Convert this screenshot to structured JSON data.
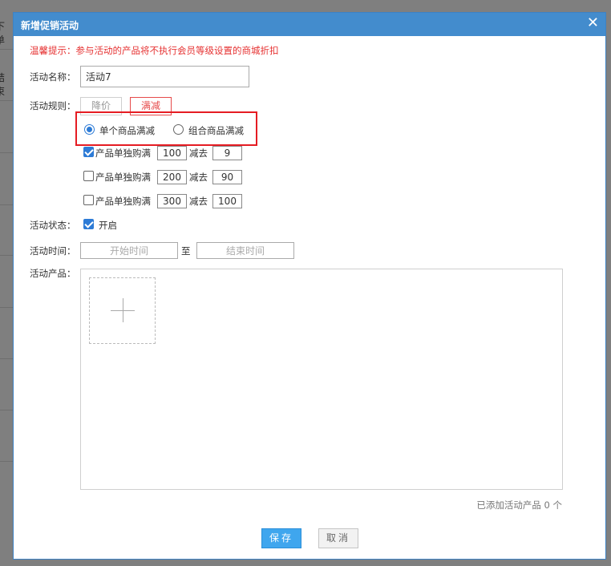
{
  "background": {
    "text_top": "下单",
    "text_mid": "结束"
  },
  "dialog": {
    "title": "新增促销活动",
    "close_glyph": "✕",
    "tip": "温馨提示：参与活动的产品将不执行会员等级设置的商城折扣",
    "name_label": "活动名称：",
    "name_value": "活动7",
    "rule_label": "活动规则：",
    "rule_tabs": [
      "降价",
      "满减"
    ],
    "active_rule": "满减",
    "mode_options": [
      {
        "label": "单个商品满减",
        "selected": true
      },
      {
        "label": "组合商品满减",
        "selected": false
      }
    ],
    "tiers": [
      {
        "checked": true,
        "label": "产品单独购满",
        "threshold": "100",
        "minus_label": "减去",
        "discount": "9"
      },
      {
        "checked": false,
        "label": "产品单独购满",
        "threshold": "200",
        "minus_label": "减去",
        "discount": "90"
      },
      {
        "checked": false,
        "label": "产品单独购满",
        "threshold": "300",
        "minus_label": "减去",
        "discount": "100"
      }
    ],
    "status_label": "活动状态：",
    "status_checked": true,
    "status_option": "开启",
    "time_label": "活动时间：",
    "start_placeholder": "开始时间",
    "to_label": "至",
    "end_placeholder": "结束时间",
    "product_label": "活动产品：",
    "add_icon": "plus-icon",
    "product_count": "已添加活动产品 0 个",
    "save_label": "保存",
    "cancel_label": "取消"
  },
  "colors": {
    "titlebar": "#438ccd",
    "tip": "#e63232",
    "highlight": "#e51c23",
    "accent": "#2d7bd6",
    "save_button": "#3fa6ee"
  }
}
